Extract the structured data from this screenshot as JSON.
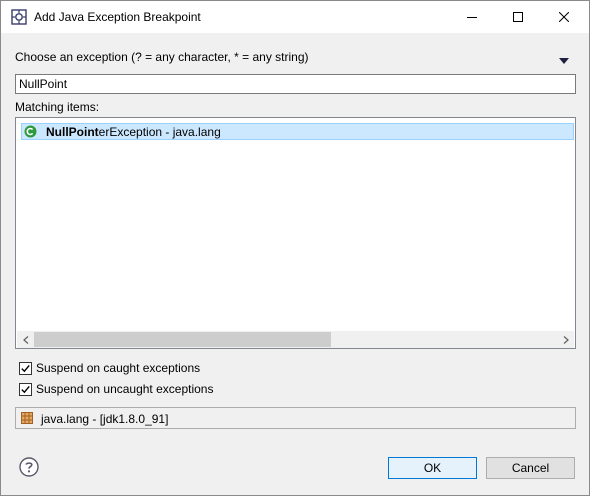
{
  "window": {
    "title": "Add Java Exception Breakpoint"
  },
  "dialog": {
    "prompt": "Choose an exception (? = any character, * = any string)",
    "search_value": "NullPoint",
    "matching_label": "Matching items:",
    "items": [
      {
        "match": "NullPoint",
        "rest": "erException - java.lang",
        "icon": "class-icon",
        "selected": true
      }
    ],
    "options": {
      "caught_label": "Suspend on caught exceptions",
      "caught_checked": true,
      "uncaught_label": "Suspend on uncaught exceptions",
      "uncaught_checked": true
    },
    "status_text": "java.lang - [jdk1.8.0_91]"
  },
  "buttons": {
    "ok_label": "OK",
    "cancel_label": "Cancel"
  },
  "colors": {
    "selection_bg": "#cce8ff",
    "default_button_border": "#0078d7",
    "class_icon_green": "#2e9a3e"
  }
}
